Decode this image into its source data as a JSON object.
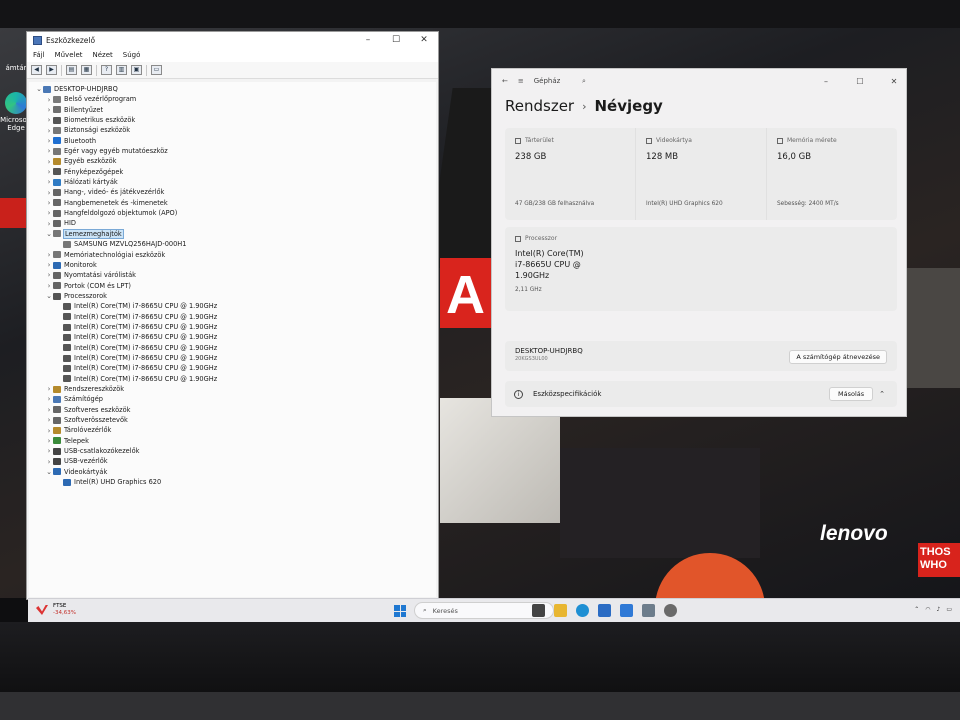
{
  "device_manager": {
    "title": "Eszközkezelő",
    "menu": [
      "Fájl",
      "Művelet",
      "Nézet",
      "Súgó"
    ],
    "tree": [
      {
        "label": "DESKTOP-UHDJRBQ",
        "level": 0,
        "expanded": true,
        "icon": "computer-icon",
        "color": "#4a78b5"
      },
      {
        "label": "Belső vezérlőprogram",
        "level": 1,
        "icon": "firmware-icon",
        "color": "#7a7a7a"
      },
      {
        "label": "Billentyűzet",
        "level": 1,
        "icon": "keyboard-icon",
        "color": "#6f6f6f"
      },
      {
        "label": "Biometrikus eszközök",
        "level": 1,
        "icon": "biometric-icon",
        "color": "#555"
      },
      {
        "label": "Biztonsági eszközök",
        "level": 1,
        "icon": "security-icon",
        "color": "#777"
      },
      {
        "label": "Bluetooth",
        "level": 1,
        "icon": "bluetooth-icon",
        "color": "#1f6fd1"
      },
      {
        "label": "Egér vagy egyéb mutatóeszköz",
        "level": 1,
        "icon": "mouse-icon",
        "color": "#777"
      },
      {
        "label": "Egyéb eszközök",
        "level": 1,
        "icon": "other-device-icon",
        "color": "#b48a2c"
      },
      {
        "label": "Fényképezőgépek",
        "level": 1,
        "icon": "camera-icon",
        "color": "#555"
      },
      {
        "label": "Hálózati kártyák",
        "level": 1,
        "icon": "network-icon",
        "color": "#2f7bc4"
      },
      {
        "label": "Hang-, videó- és játékvezérlők",
        "level": 1,
        "icon": "sound-icon",
        "color": "#666"
      },
      {
        "label": "Hangbemenetek és -kimenetek",
        "level": 1,
        "icon": "audio-io-icon",
        "color": "#666"
      },
      {
        "label": "Hangfeldolgozó objektumok (APO)",
        "level": 1,
        "icon": "apo-icon",
        "color": "#666"
      },
      {
        "label": "HID",
        "level": 1,
        "icon": "hid-icon",
        "color": "#666"
      },
      {
        "label": "Lemezmeghajtók",
        "level": 1,
        "expanded": true,
        "selected": true,
        "icon": "disk-icon",
        "color": "#777"
      },
      {
        "label": "SAMSUNG MZVLQ256HAJD-000H1",
        "level": 2,
        "icon": "disk-icon",
        "color": "#777"
      },
      {
        "label": "Memóriatechnológiai eszközök",
        "level": 1,
        "icon": "memory-icon",
        "color": "#777"
      },
      {
        "label": "Monitorok",
        "level": 1,
        "icon": "monitor-icon",
        "color": "#2d6ab3"
      },
      {
        "label": "Nyomtatási várólisták",
        "level": 1,
        "icon": "printer-icon",
        "color": "#666"
      },
      {
        "label": "Portok (COM és LPT)",
        "level": 1,
        "icon": "port-icon",
        "color": "#666"
      },
      {
        "label": "Processzorok",
        "level": 1,
        "expanded": true,
        "icon": "cpu-icon",
        "color": "#555"
      },
      {
        "label": "Intel(R) Core(TM) i7-8665U CPU @ 1.90GHz",
        "level": 2,
        "icon": "cpu-icon",
        "color": "#555"
      },
      {
        "label": "Intel(R) Core(TM) i7-8665U CPU @ 1.90GHz",
        "level": 2,
        "icon": "cpu-icon",
        "color": "#555"
      },
      {
        "label": "Intel(R) Core(TM) i7-8665U CPU @ 1.90GHz",
        "level": 2,
        "icon": "cpu-icon",
        "color": "#555"
      },
      {
        "label": "Intel(R) Core(TM) i7-8665U CPU @ 1.90GHz",
        "level": 2,
        "icon": "cpu-icon",
        "color": "#555"
      },
      {
        "label": "Intel(R) Core(TM) i7-8665U CPU @ 1.90GHz",
        "level": 2,
        "icon": "cpu-icon",
        "color": "#555"
      },
      {
        "label": "Intel(R) Core(TM) i7-8665U CPU @ 1.90GHz",
        "level": 2,
        "icon": "cpu-icon",
        "color": "#555"
      },
      {
        "label": "Intel(R) Core(TM) i7-8665U CPU @ 1.90GHz",
        "level": 2,
        "icon": "cpu-icon",
        "color": "#555"
      },
      {
        "label": "Intel(R) Core(TM) i7-8665U CPU @ 1.90GHz",
        "level": 2,
        "icon": "cpu-icon",
        "color": "#555"
      },
      {
        "label": "Rendszereszközök",
        "level": 1,
        "icon": "system-icon",
        "color": "#b48a2c"
      },
      {
        "label": "Számítógép",
        "level": 1,
        "icon": "computer-icon",
        "color": "#4a78b5"
      },
      {
        "label": "Szoftveres eszközök",
        "level": 1,
        "icon": "software-icon",
        "color": "#666"
      },
      {
        "label": "Szoftverösszetevők",
        "level": 1,
        "icon": "component-icon",
        "color": "#666"
      },
      {
        "label": "Tárolóvezérlők",
        "level": 1,
        "icon": "storage-icon",
        "color": "#b48a2c"
      },
      {
        "label": "Telepek",
        "level": 1,
        "icon": "battery-icon",
        "color": "#3a8a3a"
      },
      {
        "label": "USB-csatlakozókezelők",
        "level": 1,
        "icon": "usb-icon",
        "color": "#444"
      },
      {
        "label": "USB-vezérlők",
        "level": 1,
        "icon": "usb-icon",
        "color": "#444"
      },
      {
        "label": "Videokártyák",
        "level": 1,
        "expanded": true,
        "icon": "display-adapter-icon",
        "color": "#2d6ab3"
      },
      {
        "label": "Intel(R) UHD Graphics 620",
        "level": 2,
        "icon": "display-adapter-icon",
        "color": "#2d6ab3"
      }
    ]
  },
  "settings": {
    "title": "Gépház",
    "breadcrumb_parent": "Rendszer",
    "breadcrumb_current": "Névjegy",
    "cards": [
      {
        "label": "Tárterület",
        "value": "238 GB",
        "detail": "47 GB/238 GB felhasználva"
      },
      {
        "label": "Videokártya",
        "value": "128 MB",
        "detail": "Intel(R) UHD Graphics 620"
      },
      {
        "label": "Memória mérete",
        "value": "16,0 GB",
        "detail": "Sebesség: 2400 MT/s"
      }
    ],
    "processor_label": "Processzor",
    "processor_name": "Intel(R) Core(TM) i7-8665U CPU @ 1.90GHz",
    "processor_speed": "2,11 GHz",
    "device_name": "DESKTOP-UHDJRBQ",
    "device_sub": "20KGS3UL00",
    "rename_button": "A számítógép átnevezése",
    "specs_label": "Eszközspecifikációk",
    "copy_button": "Másolás"
  },
  "desktop": {
    "icon_top_label": "ámtár",
    "edge_label": "Microsoft Edge",
    "brand": "lenovo",
    "brand_sub": "THOS WHO",
    "wall_letter": "A"
  },
  "taskbar": {
    "weather_line1": "FTSE",
    "weather_line2": "-34,63%",
    "search_placeholder": "Keresés"
  }
}
